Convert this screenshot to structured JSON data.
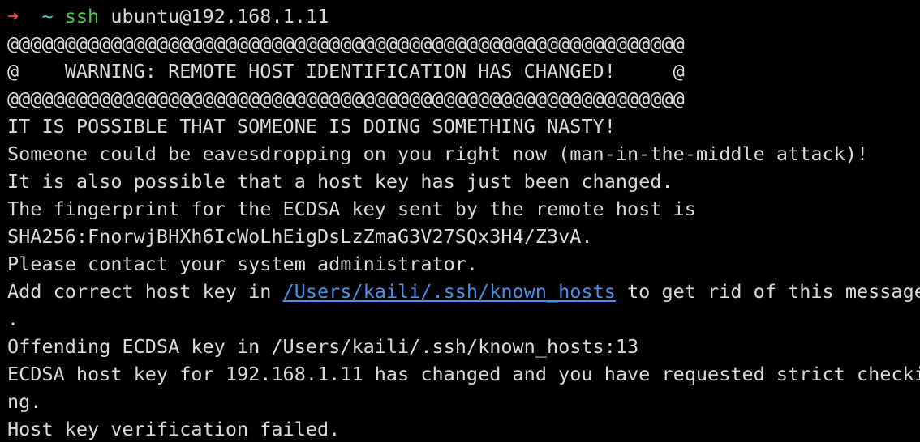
{
  "prompt": {
    "arrow": "➜",
    "dir": "~",
    "command": "ssh",
    "args": "ubuntu@192.168.1.11"
  },
  "output": {
    "banner_top": "@@@@@@@@@@@@@@@@@@@@@@@@@@@@@@@@@@@@@@@@@@@@@@@@@@@@@@@@@@@",
    "warning": "@    WARNING: REMOTE HOST IDENTIFICATION HAS CHANGED!     @",
    "banner_bottom": "@@@@@@@@@@@@@@@@@@@@@@@@@@@@@@@@@@@@@@@@@@@@@@@@@@@@@@@@@@@",
    "line1": "IT IS POSSIBLE THAT SOMEONE IS DOING SOMETHING NASTY!",
    "line2": "Someone could be eavesdropping on you right now (man-in-the-middle attack)!",
    "line3": "It is also possible that a host key has just been changed.",
    "line4": "The fingerprint for the ECDSA key sent by the remote host is",
    "line5": "SHA256:FnorwjBHXh6IcWoLhEigDsLzZmaG3V27SQx3H4/Z3vA.",
    "line6": "Please contact your system administrator.",
    "line7_prefix": "Add correct host key in ",
    "line7_link": "/Users/kaili/.ssh/known_hosts",
    "line7_suffix": " to get rid of this message",
    "line8": ".",
    "line9": "Offending ECDSA key in /Users/kaili/.ssh/known_hosts:13",
    "line10": "ECDSA host key for 192.168.1.11 has changed and you have requested strict checki",
    "line11": "ng.",
    "line12": "Host key verification failed."
  },
  "colors": {
    "background": "#000000",
    "text": "#d9d9d9",
    "prompt_arrow": "#e0483b",
    "prompt_dir": "#50c8d0",
    "prompt_command": "#4fc84a",
    "link": "#4b8fe8"
  }
}
